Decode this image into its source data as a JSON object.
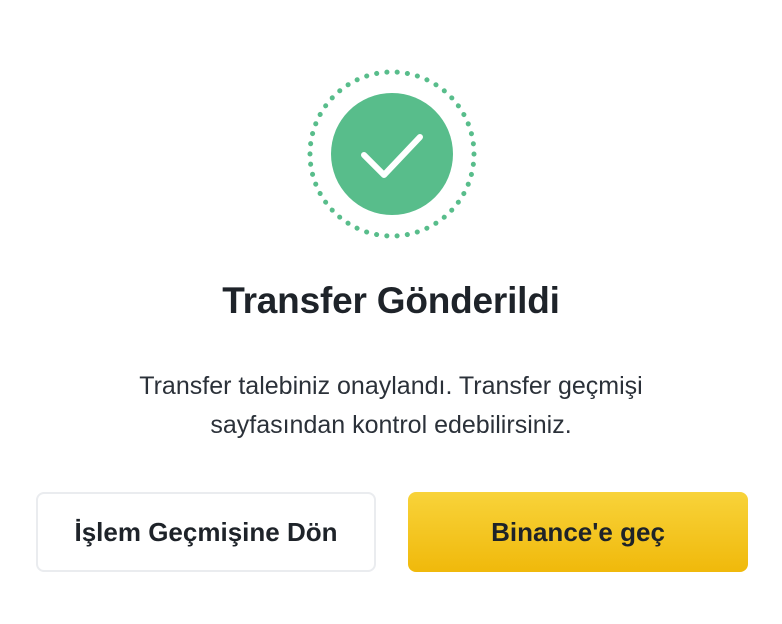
{
  "status": {
    "icon": "check-circle-icon",
    "accent_color": "#58bd8b"
  },
  "title": "Transfer Gönderildi",
  "message": {
    "line1": "Transfer talebiniz onaylandı. Transfer geçmişi",
    "line2": "sayfasından kontrol edebilirsiniz."
  },
  "buttons": {
    "history_label": "İşlem Geçmişine Dön",
    "binance_label": "Binance'e geç"
  },
  "colors": {
    "primary_button": "#f0b90b",
    "text": "#1e2329"
  }
}
